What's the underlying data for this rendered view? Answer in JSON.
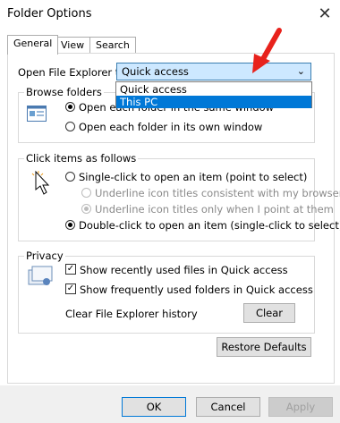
{
  "window": {
    "title": "Folder Options"
  },
  "tabs": [
    {
      "label": "General"
    },
    {
      "label": "View"
    },
    {
      "label": "Search"
    }
  ],
  "open_explorer": {
    "label": "Open File Explorer to:",
    "selected": "Quick access",
    "options": [
      "Quick access",
      "This PC"
    ],
    "highlighted_option": "This PC"
  },
  "browse_folders": {
    "title": "Browse folders",
    "options": [
      {
        "label": "Open each folder in the same window",
        "checked": true
      },
      {
        "label": "Open each folder in its own window",
        "checked": false
      }
    ]
  },
  "click_items": {
    "title": "Click items as follows",
    "options": [
      {
        "label": "Single-click to open an item (point to select)",
        "checked": false,
        "enabled": true
      },
      {
        "label": "Underline icon titles consistent with my browser",
        "checked": false,
        "enabled": false
      },
      {
        "label": "Underline icon titles only when I point at them",
        "checked": true,
        "enabled": false
      },
      {
        "label": "Double-click to open an item (single-click to select)",
        "checked": true,
        "enabled": true
      }
    ]
  },
  "privacy": {
    "title": "Privacy",
    "options": [
      {
        "label": "Show recently used files in Quick access",
        "checked": true
      },
      {
        "label": "Show frequently used folders in Quick access",
        "checked": true
      }
    ],
    "clear_label": "Clear File Explorer history",
    "clear_button": "Clear"
  },
  "restore_defaults": "Restore Defaults",
  "footer": {
    "ok": "OK",
    "cancel": "Cancel",
    "apply": "Apply"
  },
  "colors": {
    "accent": "#0078d7",
    "combo_fill": "#cde8ff",
    "arrow": "#e8221c"
  }
}
